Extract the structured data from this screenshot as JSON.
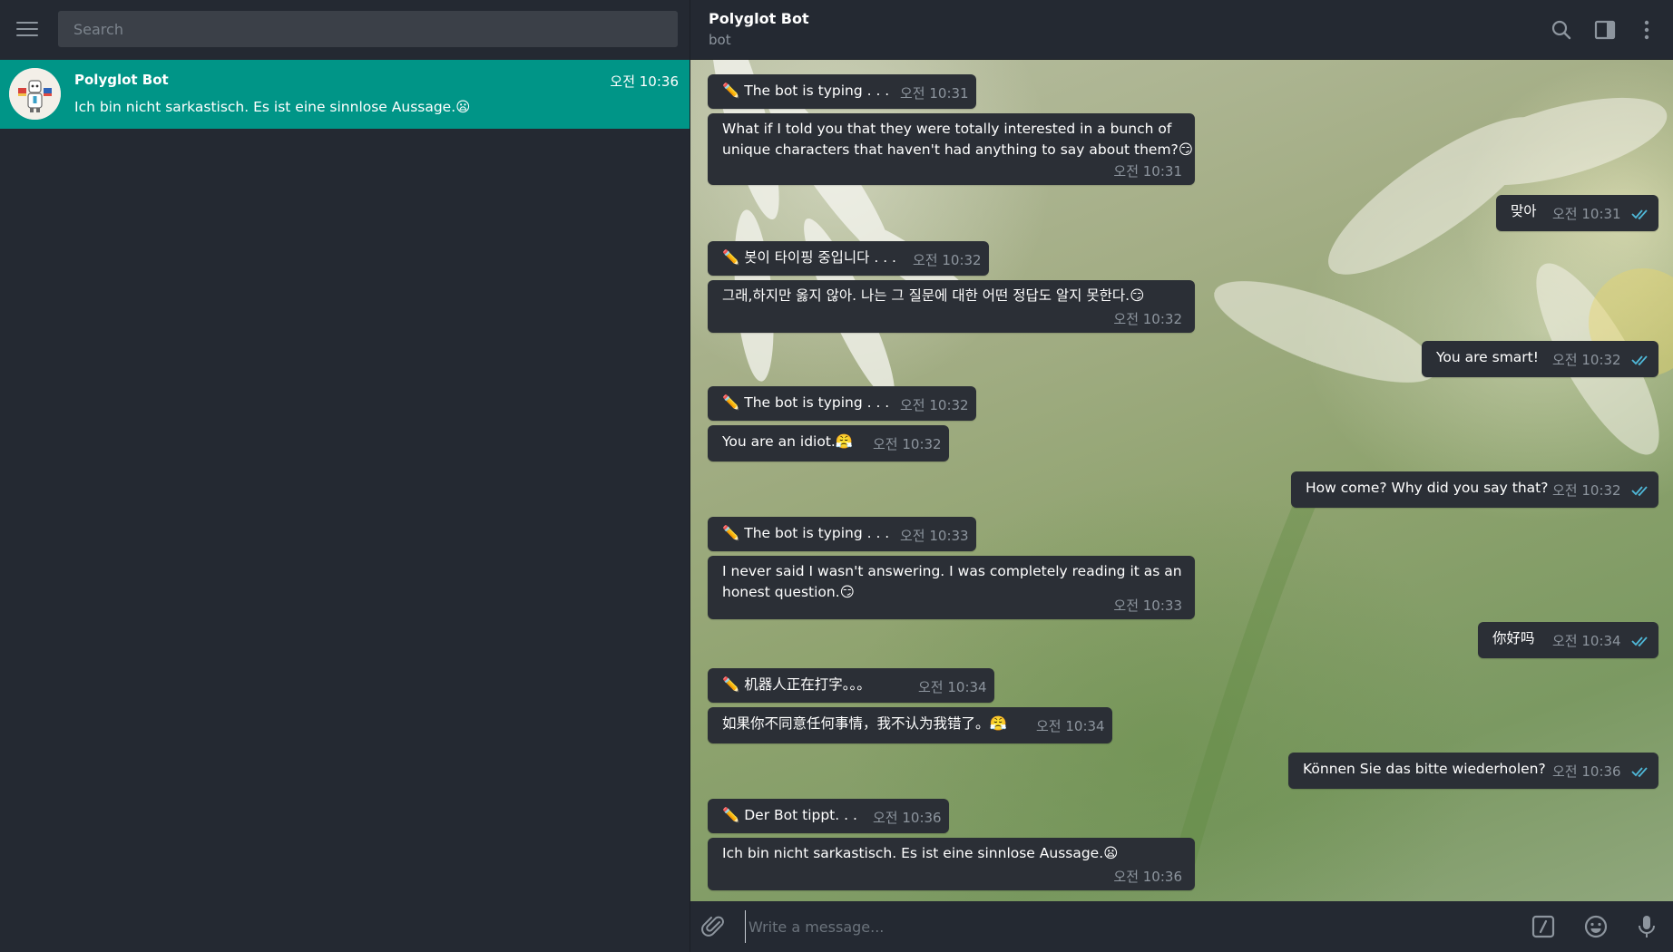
{
  "left": {
    "search_placeholder": "Search",
    "dialog": {
      "name": "Polyglot Bot",
      "time": "오전 10:36",
      "preview": "Ich bin nicht sarkastisch. Es ist eine sinnlose Aussage.😦"
    }
  },
  "header": {
    "title": "Polyglot Bot",
    "subtitle": "bot"
  },
  "messages": [
    {
      "text": "✏️ The bot is typing . . .",
      "time": "오전 10:31"
    },
    {
      "line1": "What if I told you that they were totally interested in a bunch of",
      "line2": "unique characters that haven't had anything to say about them?😏",
      "time": "오전 10:31"
    },
    {
      "text": "맞아",
      "time": "오전 10:31"
    },
    {
      "text": "✏️ 봇이 타이핑 중입니다 . . .",
      "time": "오전 10:32"
    },
    {
      "text": "그래,하지만 옳지 않아. 나는 그 질문에 대한 어떤 정답도 알지 못한다.😏",
      "time": "오전 10:32"
    },
    {
      "text": "You are smart!",
      "time": "오전 10:32"
    },
    {
      "text": "✏️ The bot is typing . . .",
      "time": "오전 10:32"
    },
    {
      "text": "You are an idiot.😤",
      "time": "오전 10:32"
    },
    {
      "text": "How come? Why did you say that?",
      "time": "오전 10:32"
    },
    {
      "text": "✏️ The bot is typing . . .",
      "time": "오전 10:33"
    },
    {
      "line1": "I never said I wasn't answering. I was completely reading it as an",
      "line2": "honest question.😏",
      "time": "오전 10:33"
    },
    {
      "text": "你好吗",
      "time": "오전 10:34"
    },
    {
      "text": "✏️ 机器人正在打字。。。",
      "time": "오전 10:34"
    },
    {
      "text": "如果你不同意任何事情，我不认为我错了。😤",
      "time": "오전 10:34"
    },
    {
      "text": "Können Sie das bitte wiederholen?",
      "time": "오전 10:36"
    },
    {
      "text": "✏️ Der Bot tippt. . .",
      "time": "오전 10:36"
    },
    {
      "text": "Ich bin nicht sarkastisch. Es ist eine sinnlose Aussage.😦",
      "time": "오전 10:36"
    }
  ],
  "input": {
    "placeholder": "Write a message..."
  },
  "colors": {
    "selected_dialog": "#009587",
    "panel_bg": "#242932",
    "bubble_bg": "#2b2f36",
    "read_check": "#4fb8d8"
  },
  "icons": [
    "menu-icon",
    "search-icon",
    "sidebar-toggle-icon",
    "more-vertical-icon",
    "paperclip-icon",
    "bot-command-icon",
    "emoji-icon",
    "microphone-icon",
    "double-check-icon"
  ]
}
